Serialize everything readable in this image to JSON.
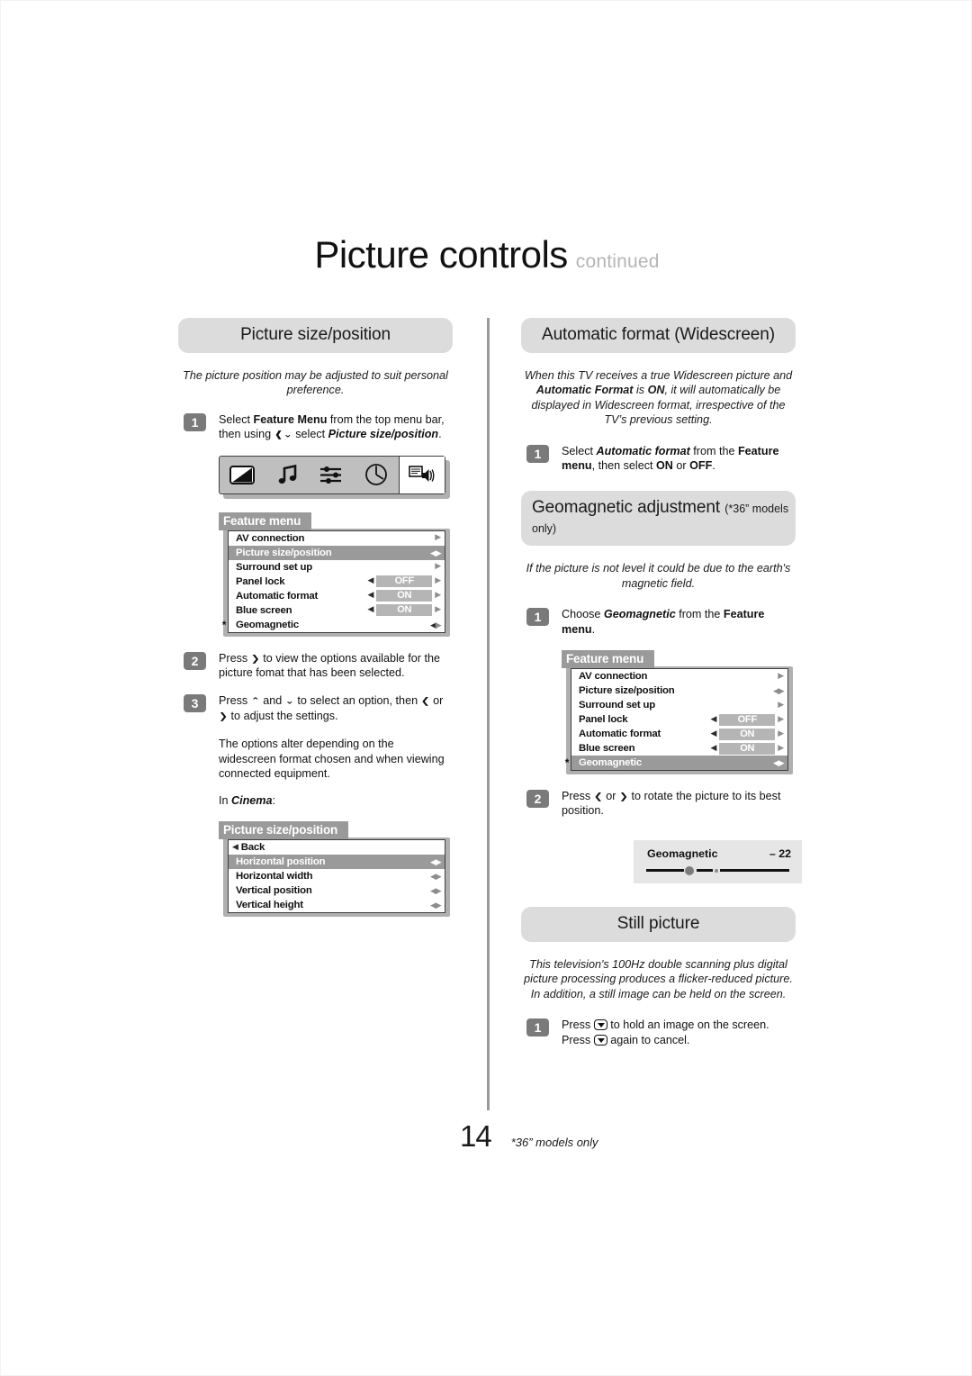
{
  "header": {
    "title": "Picture controls",
    "continued": "continued"
  },
  "left_column": {
    "section": {
      "banner": "Picture size/position",
      "intro": "The picture position may be adjusted to suit personal preference.",
      "steps": [
        {
          "num": "1",
          "text_parts": [
            "Select ",
            "Feature Menu",
            " from the top menu bar, then using ",
            "⌄",
            " select ",
            "Picture size/position",
            "."
          ]
        },
        {
          "num": "2",
          "text": "Press ❯ to view the options available for the picture fomat that has been selected."
        },
        {
          "num": "3",
          "text": "Press ⌃ and ⌄ to select an option, then ❮ or ❯ to adjust the settings."
        }
      ],
      "note": "The options alter depending on the widescreen format chosen and when viewing connected equipment.",
      "cinema_label": "In Cinema:"
    },
    "icon_bar": {
      "icons": [
        "picture-icon",
        "sound-icon",
        "feature-icon",
        "clock-icon",
        "teletext-icon"
      ],
      "active_index": 4
    },
    "feature_menu": {
      "title": "Feature menu",
      "rows": [
        {
          "label": "AV connection",
          "value": null,
          "arrows": "right",
          "selected": false,
          "star": false
        },
        {
          "label": "Picture size/position",
          "value": null,
          "arrows": "left-right",
          "selected": true,
          "star": false
        },
        {
          "label": "Surround set up",
          "value": null,
          "arrows": "right",
          "selected": false,
          "star": false
        },
        {
          "label": "Panel lock",
          "value": "OFF",
          "arrows": "both-value",
          "selected": false,
          "star": false
        },
        {
          "label": "Automatic format",
          "value": "ON",
          "arrows": "both-value",
          "selected": false,
          "star": false
        },
        {
          "label": "Blue screen",
          "value": "ON",
          "arrows": "both-value",
          "selected": false,
          "star": false
        },
        {
          "label": "Geomagnetic",
          "value": null,
          "arrows": "left-right",
          "selected": false,
          "star": true
        }
      ]
    },
    "size_menu": {
      "title": "Picture size/position",
      "rows": [
        {
          "label": "Back",
          "back": true,
          "arrows": "none",
          "selected": false
        },
        {
          "label": "Horizontal  position",
          "back": false,
          "arrows": "left-right",
          "selected": true
        },
        {
          "label": "Horizontal  width",
          "back": false,
          "arrows": "left-right",
          "selected": false
        },
        {
          "label": "Vertical  position",
          "back": false,
          "arrows": "left-right",
          "selected": false
        },
        {
          "label": "Vertical  height",
          "back": false,
          "arrows": "left-right",
          "selected": false
        }
      ]
    }
  },
  "right_column": {
    "auto_format": {
      "banner": "Automatic format (Widescreen)",
      "intro": "When this TV receives a true Widescreen picture and Automatic Format is ON, it will automatically be displayed in Widescreen format, irrespective of the TV's previous setting.",
      "step_num": "1",
      "step_text": "Select Automatic format from the Feature menu, then select ON or OFF."
    },
    "geomagnetic": {
      "banner_main": "Geomagnetic adjustment",
      "banner_sub": "(*36” models only)",
      "intro": "If the picture is not level it could be due to the earth's magnetic field.",
      "step1_num": "1",
      "step1_text": "Choose Geomagnetic from the Feature menu.",
      "step2_num": "2",
      "step2_text": "Press ❮ or ❯ to rotate the picture to its best position.",
      "feature_menu": {
        "title": "Feature menu",
        "rows": [
          {
            "label": "AV connection",
            "value": null,
            "arrows": "right",
            "selected": false,
            "star": false
          },
          {
            "label": "Picture size/position",
            "value": null,
            "arrows": "left-right",
            "selected": false,
            "star": false
          },
          {
            "label": "Surround set up",
            "value": null,
            "arrows": "right",
            "selected": false,
            "star": false
          },
          {
            "label": "Panel lock",
            "value": "OFF",
            "arrows": "both-value",
            "selected": false,
            "star": false
          },
          {
            "label": "Automatic format",
            "value": "ON",
            "arrows": "both-value",
            "selected": false,
            "star": false
          },
          {
            "label": "Blue screen",
            "value": "ON",
            "arrows": "both-value",
            "selected": false,
            "star": false
          },
          {
            "label": "Geomagnetic",
            "value": null,
            "arrows": "left-right",
            "selected": true,
            "star": true
          }
        ]
      },
      "slider": {
        "label": "Geomagnetic",
        "value": "– 22"
      }
    },
    "still_picture": {
      "banner": "Still picture",
      "intro": "This television's 100Hz double scanning plus digital picture processing produces a flicker-reduced picture. In addition, a still image can be held on the screen.",
      "step_num": "1",
      "step_text": "Press ▼ to hold an image on the screen. Press ▼ again to cancel."
    }
  },
  "footer": {
    "page_number": "14",
    "footnote": "*36” models only"
  }
}
